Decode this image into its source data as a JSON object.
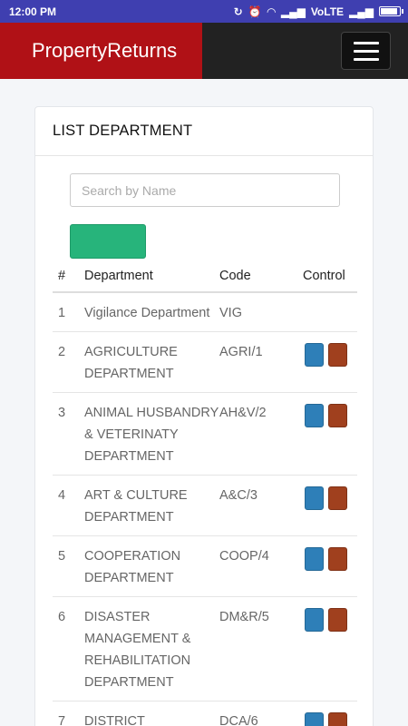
{
  "statusbar": {
    "time": "12:00 PM",
    "network": "VoLTE",
    "icons": [
      "sync-off-icon",
      "alarm-icon",
      "wifi-icon",
      "signal-icon",
      "signal-icon",
      "battery-icon"
    ]
  },
  "navbar": {
    "brand": "PropertyReturns",
    "menu_icon": "hamburger-icon"
  },
  "card": {
    "title": "LIST DEPARTMENT",
    "search_placeholder": "Search by Name",
    "add_button_label": ""
  },
  "table": {
    "headers": {
      "num": "#",
      "dept": "Department",
      "code": "Code",
      "control": "Control"
    },
    "rows": [
      {
        "num": "1",
        "dept": "Vigilance Department",
        "code": "VIG",
        "controls": false
      },
      {
        "num": "2",
        "dept": "AGRICULTURE DEPARTMENT",
        "code": "AGRI/1",
        "controls": true
      },
      {
        "num": "3",
        "dept": "ANIMAL HUSBANDRY & VETERINATY DEPARTMENT",
        "code": "AH&V/2",
        "controls": true
      },
      {
        "num": "4",
        "dept": "ART & CULTURE DEPARTMENT",
        "code": "A&C/3",
        "controls": true
      },
      {
        "num": "5",
        "dept": "COOPERATION DEPARTMENT",
        "code": "COOP/4",
        "controls": true
      },
      {
        "num": "6",
        "dept": "DISASTER MANAGEMENT & REHABILITATION DEPARTMENT",
        "code": "DM&R/5",
        "controls": true
      },
      {
        "num": "7",
        "dept": "DISTRICT",
        "code": "DCA/6",
        "controls": true
      }
    ]
  },
  "colors": {
    "statusbar": "#3f3fb0",
    "brand_bg": "#b01116",
    "navbar_bg": "#222222",
    "add_button": "#27b47b",
    "edit_button": "#2e7fb8",
    "delete_button": "#a0401e"
  }
}
